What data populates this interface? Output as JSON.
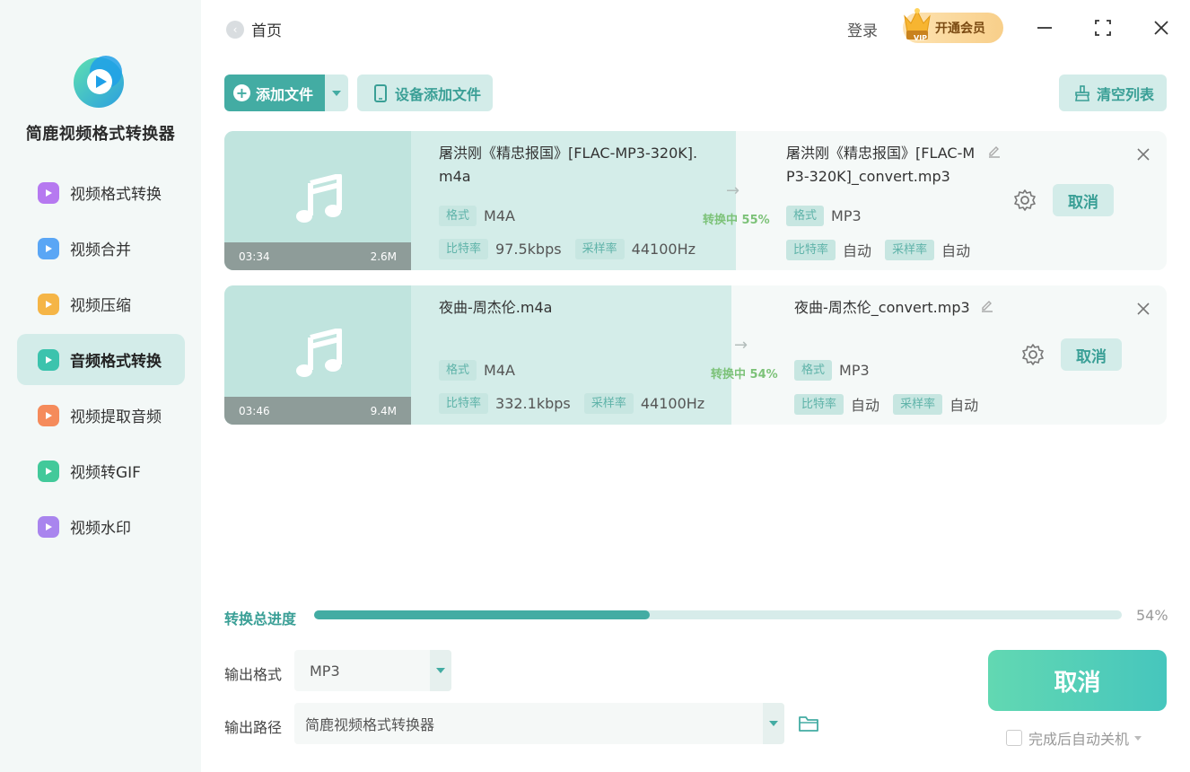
{
  "app": {
    "name": "简鹿视频格式转换器"
  },
  "sidebar": {
    "items": [
      {
        "label": "视频格式转换",
        "icon": "video-convert-icon",
        "color": "#b679f0"
      },
      {
        "label": "视频合并",
        "icon": "video-merge-icon",
        "color": "#5aa6f5"
      },
      {
        "label": "视频压缩",
        "icon": "video-compress-icon",
        "color": "#f5b546"
      },
      {
        "label": "音频格式转换",
        "icon": "audio-convert-icon",
        "color": "#3cc3ad",
        "active": true
      },
      {
        "label": "视频提取音频",
        "icon": "extract-audio-icon",
        "color": "#f58b5b"
      },
      {
        "label": "视频转GIF",
        "icon": "video-gif-icon",
        "color": "#42c99a"
      },
      {
        "label": "视频水印",
        "icon": "watermark-icon",
        "color": "#a985ee"
      }
    ]
  },
  "topbar": {
    "home_label": "首页",
    "login_label": "登录",
    "vip_label": "开通会员",
    "vip_badge": "VIP"
  },
  "toolbar": {
    "add_file_label": "添加文件",
    "device_add_label": "设备添加文件",
    "clear_list_label": "清空列表"
  },
  "labels": {
    "format": "格式",
    "bitrate": "比特率",
    "samplerate": "采样率",
    "cancel": "取消"
  },
  "files": [
    {
      "duration": "03:34",
      "size": "2.6M",
      "source_name": "屠洪刚《精忠报国》[FLAC-MP3-320K].m4a",
      "source_format": "M4A",
      "source_bitrate": "97.5kbps",
      "source_samplerate": "44100Hz",
      "status": "转换中 55%",
      "progress": 0.55,
      "output_name": "屠洪刚《精忠报国》[FLAC-MP3-320K]_convert.mp3",
      "output_format": "MP3",
      "output_bitrate": "自动",
      "output_samplerate": "自动"
    },
    {
      "duration": "03:46",
      "size": "9.4M",
      "source_name": "夜曲-周杰伦.m4a",
      "source_format": "M4A",
      "source_bitrate": "332.1kbps",
      "source_samplerate": "44100Hz",
      "status": "转换中 54%",
      "progress": 0.54,
      "output_name": "夜曲-周杰伦_convert.mp3",
      "output_format": "MP3",
      "output_bitrate": "自动",
      "output_samplerate": "自动"
    }
  ],
  "bottom": {
    "total_progress_label": "转换总进度",
    "total_progress": 0.415,
    "total_percent_text": "54%",
    "output_format_label": "输出格式",
    "output_format_value": "MP3",
    "output_path_label": "输出路径",
    "output_path_value": "简鹿视频格式转换器",
    "cancel_all_label": "取消",
    "shutdown_label": "完成后自动关机"
  },
  "colors": {
    "accent": "#43aca3",
    "accent_light": "#d3ece9",
    "status_green": "#7cc278"
  }
}
